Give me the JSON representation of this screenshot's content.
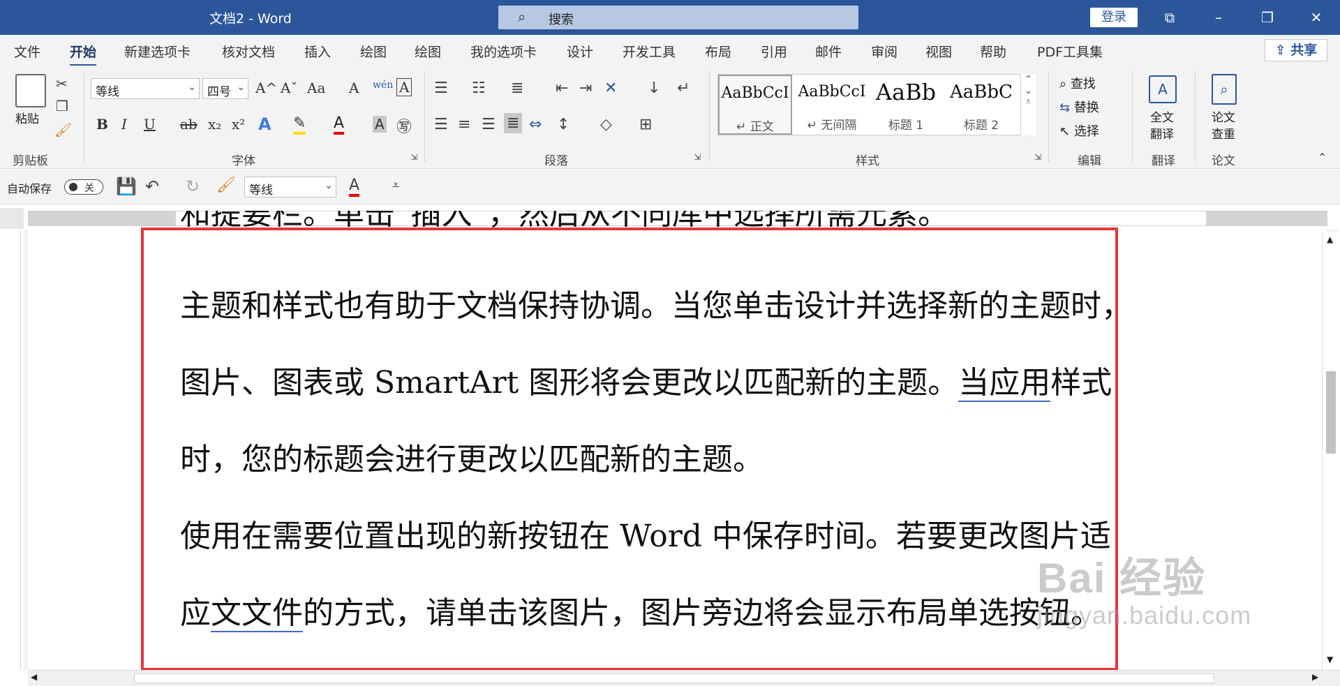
{
  "window": {
    "title": "文档2 - Word",
    "search_placeholder": "搜索",
    "login_label": "登录",
    "controls": {
      "ribbon_display": "⧉",
      "minimize": "–",
      "maximize": "❐",
      "close": "✕"
    }
  },
  "menu": {
    "tabs": [
      "文件",
      "开始",
      "新建选项卡",
      "核对文档",
      "插入",
      "绘图",
      "绘图",
      "我的选项卡",
      "设计",
      "开发工具",
      "布局",
      "引用",
      "邮件",
      "审阅",
      "视图",
      "帮助",
      "PDF工具集"
    ],
    "active_tab": "开始",
    "share_label": "共享"
  },
  "ribbon": {
    "clipboard": {
      "paste_label": "粘贴",
      "group_label": "剪贴板"
    },
    "font": {
      "font_name": "等线",
      "font_size": "四号",
      "group_label": "字体",
      "buttons": {
        "bold": "B",
        "italic": "I",
        "underline": "U",
        "strike": "ab",
        "subscript": "x₂",
        "superscript": "x²",
        "grow": "A^",
        "shrink": "Aˇ",
        "case": "Aa",
        "clear": "A",
        "phonetic": "wén",
        "border_char": "A"
      }
    },
    "paragraph": {
      "group_label": "段落"
    },
    "styles": {
      "group_label": "样式",
      "items": [
        {
          "preview": "AaBbCcI",
          "name": "↵ 正文"
        },
        {
          "preview": "AaBbCcI",
          "name": "↵ 无间隔"
        },
        {
          "preview": "AaBb",
          "name": "标题 1"
        },
        {
          "preview": "AaBbC",
          "name": "标题 2"
        }
      ]
    },
    "editing": {
      "find": "查找",
      "replace": "替换",
      "select": "选择",
      "group_label": "编辑"
    },
    "translate": {
      "label_line1": "全文",
      "label_line2": "翻译",
      "group_label": "翻译"
    },
    "paper": {
      "label_line1": "论文",
      "label_line2": "查重",
      "group_label": "论文"
    }
  },
  "qat": {
    "autosave_label": "自动保存",
    "toggle_state": "关",
    "font_name": "等线",
    "font_color_letter": "A"
  },
  "document": {
    "cut_line": "和提要栏。单击“插入”，然后从不同库中选择所需元素。",
    "lines": [
      {
        "a": "主题和样式也有助于文档保持协调。当您单击设计并选择新的主题时，",
        "u": "",
        "b": ""
      },
      {
        "a": "图片、图表或 SmartArt 图形将会更改以匹配新的主题。",
        "u": "当应用",
        "b": "样式"
      },
      {
        "a": "时，您的标题会进行更改以匹配新的主题。",
        "u": "",
        "b": ""
      },
      {
        "a": "使用在需要位置出现的新按钮在 Word 中保存时间。若要更改图片适",
        "u": "",
        "b": ""
      },
      {
        "a": "应",
        "u": "文文件",
        "b": "的方式，请单击该图片，图片旁边将会显示布局单选按钮。"
      }
    ]
  },
  "watermark": {
    "brand": "Bai 经验",
    "url": "jingyan.baidu.com"
  },
  "colors": {
    "title_bar": "#2b579a",
    "highlight_box": "#e8353a",
    "underline": "#3e6bc5"
  }
}
